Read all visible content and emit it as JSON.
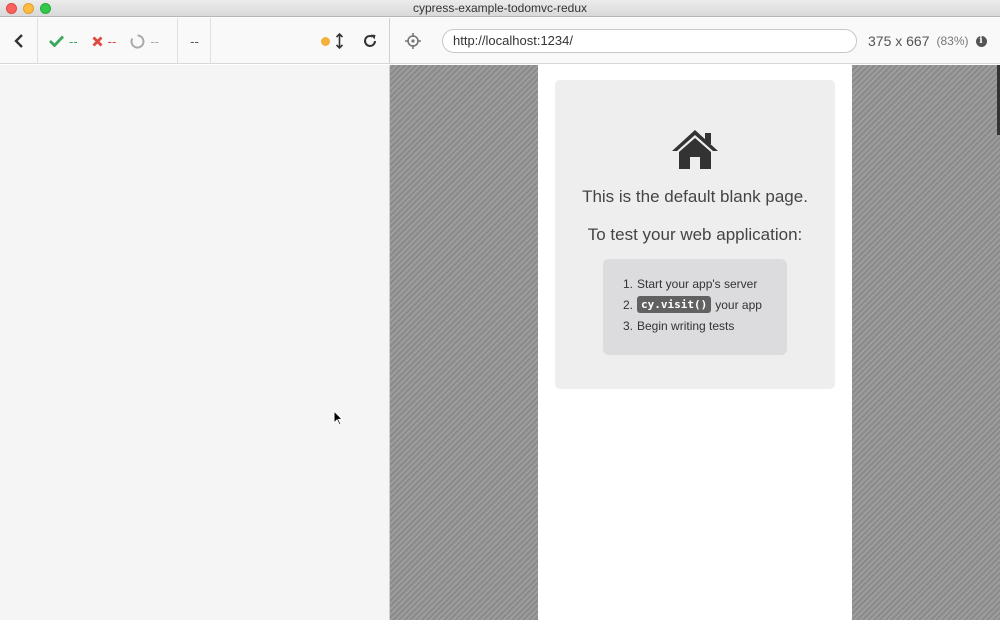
{
  "window": {
    "title": "cypress-example-todomvc-redux"
  },
  "reporter": {
    "stats": {
      "passed": "--",
      "failed": "--",
      "pending": "--"
    },
    "duration": "--",
    "colors": {
      "passed": "#3aa85b",
      "failed": "#e0473e",
      "auto_scroll": "#f4b23a"
    }
  },
  "runner": {
    "url": "http://localhost:1234/",
    "viewport_size": "375 x 667",
    "viewport_scale": "(83%)"
  },
  "blank_page": {
    "title": "This is the default blank page.",
    "subtitle": "To test your web application:",
    "steps": [
      {
        "num": "1.",
        "text": "Start your app's server"
      },
      {
        "num": "2.",
        "code": "cy.visit()",
        "text": "your app"
      },
      {
        "num": "3.",
        "text": "Begin writing tests"
      }
    ]
  }
}
